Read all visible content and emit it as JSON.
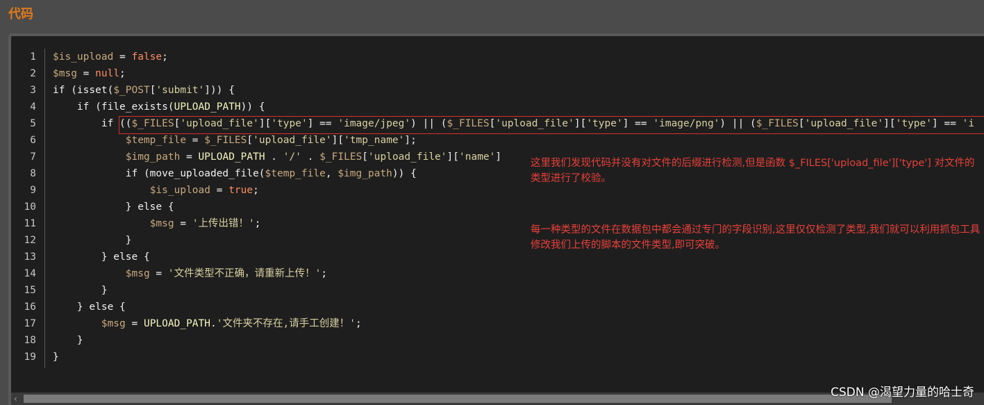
{
  "header": {
    "title": "代码"
  },
  "code": {
    "lines": [
      {
        "n": "1"
      },
      {
        "n": "2"
      },
      {
        "n": "3"
      },
      {
        "n": "4"
      },
      {
        "n": "5"
      },
      {
        "n": "6"
      },
      {
        "n": "7"
      },
      {
        "n": "8"
      },
      {
        "n": "9"
      },
      {
        "n": "10"
      },
      {
        "n": "11"
      },
      {
        "n": "12"
      },
      {
        "n": "13"
      },
      {
        "n": "14"
      },
      {
        "n": "15"
      },
      {
        "n": "16"
      },
      {
        "n": "17"
      },
      {
        "n": "18"
      },
      {
        "n": "19"
      }
    ],
    "text": {
      "l1": [
        "$is_upload",
        " = ",
        "false",
        ";"
      ],
      "l2": [
        "$msg",
        " = ",
        "null",
        ";"
      ],
      "l3": [
        "if (isset(",
        "$_POST",
        "[",
        "'submit'",
        "])) {"
      ],
      "l4": [
        "    if (file_exists(",
        "UPLOAD_PATH",
        ")) {"
      ],
      "l5": [
        "        if ((",
        "$_FILES",
        "[",
        "'upload_file'",
        "][",
        "'type'",
        "] == ",
        "'image/jpeg'",
        ") || (",
        "$_FILES",
        "[",
        "'upload_file'",
        "][",
        "'type'",
        "] == ",
        "'image/png'",
        ") || (",
        "$_FILES",
        "[",
        "'upload_file'",
        "][",
        "'type'",
        "] == ",
        "'i"
      ],
      "l6": [
        "            ",
        "$temp_file",
        " = ",
        "$_FILES",
        "[",
        "'upload_file'",
        "][",
        "'tmp_name'",
        "];"
      ],
      "l7": [
        "            ",
        "$img_path",
        " = ",
        "UPLOAD_PATH",
        " . ",
        "'/'",
        " . ",
        "$_FILES",
        "[",
        "'upload_file'",
        "][",
        "'name'",
        "]"
      ],
      "l8": [
        "            if (move_uploaded_file(",
        "$temp_file",
        ", ",
        "$img_path",
        ")) {"
      ],
      "l9": [
        "                ",
        "$is_upload",
        " = ",
        "true",
        ";"
      ],
      "l10": [
        "            } else {"
      ],
      "l11": [
        "                ",
        "$msg",
        " = ",
        "'上传出错！'",
        ";"
      ],
      "l12": [
        "            }"
      ],
      "l13": [
        "        } else {"
      ],
      "l14": [
        "            ",
        "$msg",
        " = ",
        "'文件类型不正确，请重新上传！'",
        ";"
      ],
      "l15": [
        "        }"
      ],
      "l16": [
        "    } else {"
      ],
      "l17": [
        "        ",
        "$msg",
        " = ",
        "UPLOAD_PATH",
        ".",
        "'文件夹不存在,请手工创建！'",
        ";"
      ],
      "l18": [
        "    }"
      ],
      "l19": [
        "}"
      ]
    }
  },
  "annotations": {
    "a1": "这里我们发现代码并没有对文件的后缀进行检测,但是函数 $_FILES['upload_file']['type'] 对文件的类型进行了校验。",
    "a2": "每一种类型的文件在数据包中都会通过专门的字段识别,这里仅仅检测了类型,我们就可以利用抓包工具修改我们上传的脚本的文件类型,即可突破。"
  },
  "scroll": {
    "left_arrow": "‹"
  },
  "watermark": "CSDN @渴望力量的哈士奇",
  "colors": {
    "header": "#e0791c",
    "annotation": "#e8403a",
    "highlight_border": "#d9302c"
  }
}
